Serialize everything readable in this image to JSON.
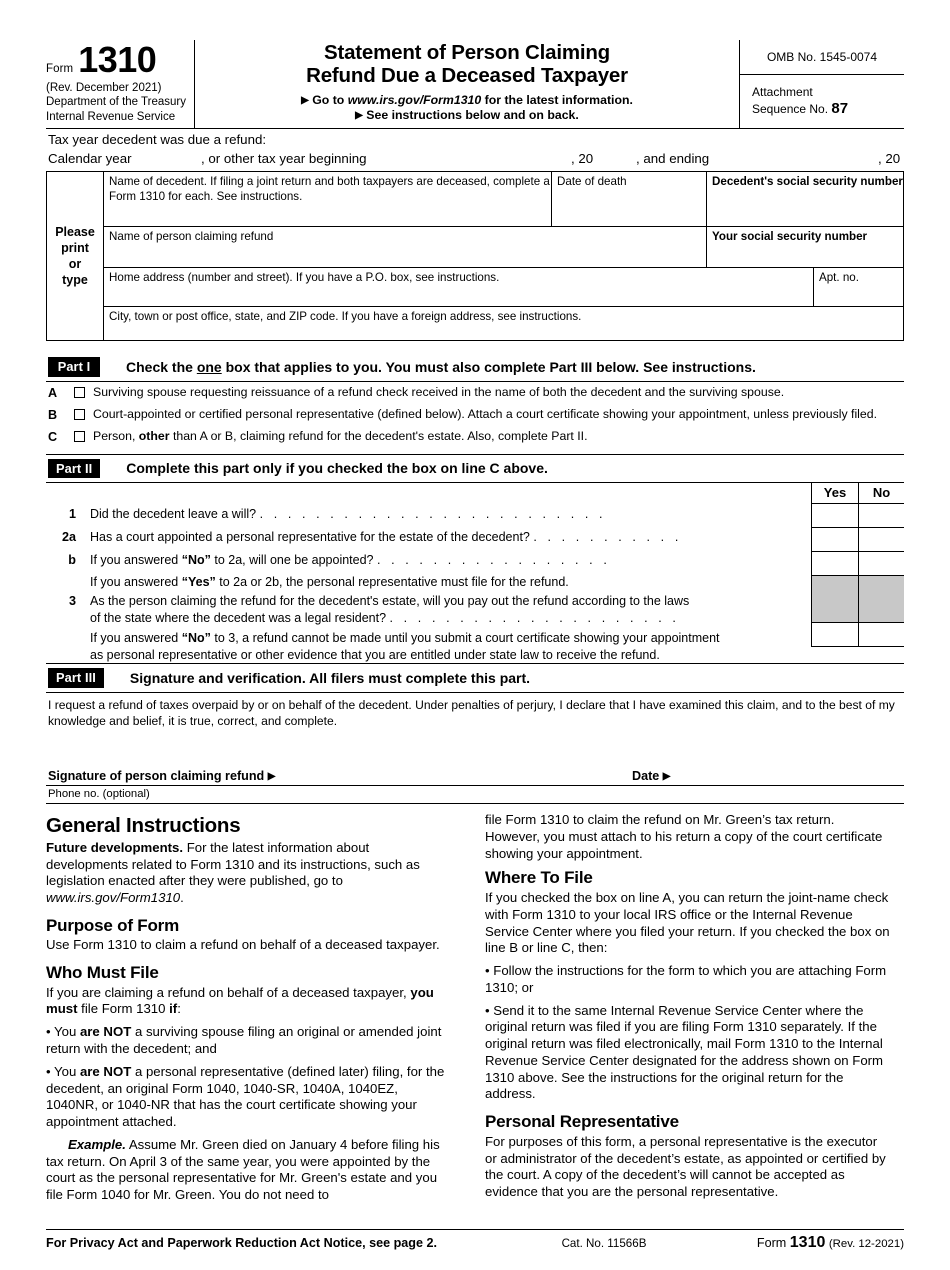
{
  "header": {
    "form_word": "Form",
    "form_number": "1310",
    "revision": "(Rev. December 2021)",
    "dept_line1": "Department of the Treasury",
    "dept_line2": "Internal Revenue Service",
    "title_line1": "Statement of Person Claiming",
    "title_line2": "Refund Due a Deceased Taxpayer",
    "goto_prefix": "Go to",
    "goto_url": "www.irs.gov/Form1310",
    "goto_suffix": "for the latest information.",
    "see_instructions": "See instructions below and on back.",
    "omb": "OMB No. 1545-0074",
    "attachment_label_line1": "Attachment",
    "attachment_label_line2": "Sequence No.",
    "attachment_sequence": "87"
  },
  "taxyear": {
    "heading": "Tax year decedent was due a refund:",
    "calendar_year": "Calendar year",
    "other_tax_year": ", or other tax year beginning",
    "comma20_begin": ", 20",
    "and_ending": ", and ending",
    "comma20_end": ", 20"
  },
  "entity": {
    "side_label_line1": "Please",
    "side_label_line2": "print",
    "side_label_line3": "or",
    "side_label_line4": "type",
    "decedent_name": "Name of decedent. If filing a joint return and both taxpayers are deceased, complete a Form 1310 for each. See instructions.",
    "date_of_death": "Date of death",
    "decedent_ssn": "Decedent's social security number",
    "claimant_name": "Name of person claiming refund",
    "your_ssn": "Your social security number",
    "home_address": "Home address (number and street). If you have a P.O. box, see instructions.",
    "apt_no": "Apt. no.",
    "city_state_zip": "City, town or post office, state, and ZIP code. If you have a foreign address, see instructions."
  },
  "part1": {
    "tag": "Part I",
    "heading_pre": "Check the ",
    "heading_underlined": "one",
    "heading_post": " box that applies to you.  You must also complete Part III below.  See instructions.",
    "options": [
      {
        "letter": "A",
        "text": "Surviving spouse requesting reissuance of a refund check received in the name of both the decedent and the surviving spouse.",
        "checked": false
      },
      {
        "letter": "B",
        "text": "Court-appointed or certified personal representative (defined below). Attach a court certificate showing your appointment, unless previously filed.",
        "checked": false
      },
      {
        "letter": "C",
        "text_pre": "Person, ",
        "text_bold": "other",
        "text_post": " than A or B, claiming refund for the decedent's estate. Also, complete Part II.",
        "checked": false
      }
    ]
  },
  "part2": {
    "tag": "Part II",
    "heading": "Complete this part only if you checked the box on line C above.",
    "yes_header": "Yes",
    "no_header": "No",
    "questions": [
      {
        "num": "1",
        "text": "Did the decedent leave a will?",
        "leader": ". . . . . . . . . . . . . . . . . . . . . . . . ."
      },
      {
        "num": "2a",
        "text": "Has a court appointed a personal representative for the estate of the decedent?",
        "leader": ". . . . . . . . . . ."
      },
      {
        "num": "b",
        "text_pre": "If you answered ",
        "text_bold": "“No”",
        "text_post": " to 2a, will one be appointed?",
        "leader": ". . . . . . . . . . . . . . . . ."
      }
    ],
    "note_yes_pre": "If you answered ",
    "note_yes_bold": "“Yes”",
    "note_yes_post": " to 2a or 2b, the personal representative must file for the refund.",
    "q3_num": "3",
    "q3_line1": "As the person claiming the refund for the decedent's estate, will you pay out the refund according to the laws",
    "q3_line2": "of the state where the decedent was a legal resident?",
    "q3_leader": ". . . . . . . . . . . . . . . . . . . . .",
    "note_no_pre": "If you answered ",
    "note_no_bold": "“No”",
    "note_no_post": " to 3, a refund cannot be made until you submit a court certificate showing your appointment",
    "note_no_line2": "as personal representative or other evidence that you are entitled under state law to receive the refund."
  },
  "part3": {
    "tag": "Part III",
    "heading": "Signature and verification. All filers must complete this part.",
    "declaration": "I request a refund of taxes overpaid by or on behalf of the decedent. Under penalties of perjury, I declare that I have examined this claim, and to the best of my knowledge and belief, it is true, correct, and complete.",
    "signature_label": "Signature of person claiming refund",
    "date_label": "Date",
    "phone_label": "Phone no. (optional)",
    "signature_value": "",
    "date_value": "",
    "phone_value": ""
  },
  "instructions": {
    "left": {
      "general_heading": "General Instructions",
      "future_dev_bold": "Future developments.",
      "future_dev_text": " For the latest information about developments related to Form 1310 and its instructions, such as legislation enacted after they were published, go to ",
      "future_dev_url": "www.irs.gov/Form1310",
      "future_dev_end": ".",
      "purpose_heading": "Purpose of Form",
      "purpose_text": "Use Form 1310 to claim a refund on behalf of a deceased taxpayer.",
      "who_heading": "Who Must File",
      "who_intro_pre": "If you are claiming a refund on behalf of a deceased taxpayer, ",
      "who_intro_bold": "you must",
      "who_intro_mid": " file Form 1310 ",
      "who_intro_bold2": "if",
      "who_intro_end": ":",
      "bullet1_pre": "• You ",
      "bullet1_bold": "are NOT",
      "bullet1_post": " a surviving spouse filing an original or amended joint return with the decedent; and",
      "bullet2_pre": "• You ",
      "bullet2_bold": "are NOT",
      "bullet2_post": " a personal representative (defined later) filing, for the decedent, an original Form 1040, 1040-SR, 1040A, 1040EZ, 1040NR, or 1040-NR that has the court certificate showing your appointment attached.",
      "example_bold": "Example.",
      "example_text": " Assume Mr. Green died on January 4 before filing his tax return. On April 3 of the same year, you were appointed by the court as the personal representative for Mr. Green's estate and you file Form 1040 for Mr. Green. You do not need to"
    },
    "right": {
      "continuation": "file Form 1310 to claim the refund on Mr. Green’s tax return. However, you must attach to his return a copy of the court certificate showing your appointment.",
      "where_heading": "Where To File",
      "where_text": "If you checked the box on line A, you can return the joint-name check with Form 1310 to your local IRS office or the Internal Revenue Service Center where you filed your return. If you checked the box on line B or line C, then:",
      "where_bullet1": "• Follow the instructions for the form to which you are attaching Form 1310; or",
      "where_bullet2": "• Send it to the same Internal Revenue Service Center where the original return was filed if you are filing Form 1310 separately. If the original return was filed electronically, mail Form 1310 to the Internal Revenue Service Center designated for the address shown on Form 1310 above. See the instructions for the original return for the address.",
      "pr_heading": "Personal Representative",
      "pr_text": "For purposes of this form, a personal representative is the executor or administrator of the decedent’s estate, as appointed or certified by the court. A copy of the decedent’s will cannot be accepted as evidence that you are the personal representative."
    }
  },
  "footer": {
    "privacy_notice": "For Privacy Act and Paperwork Reduction Act Notice, see page 2.",
    "cat_no": "Cat. No. 11566B",
    "form_word": "Form",
    "form_number": "1310",
    "revision": "(Rev. 12-2021)"
  },
  "colors": {
    "ink": "#000000",
    "paper": "#ffffff",
    "shaded_cell": "#c8c8c8"
  }
}
